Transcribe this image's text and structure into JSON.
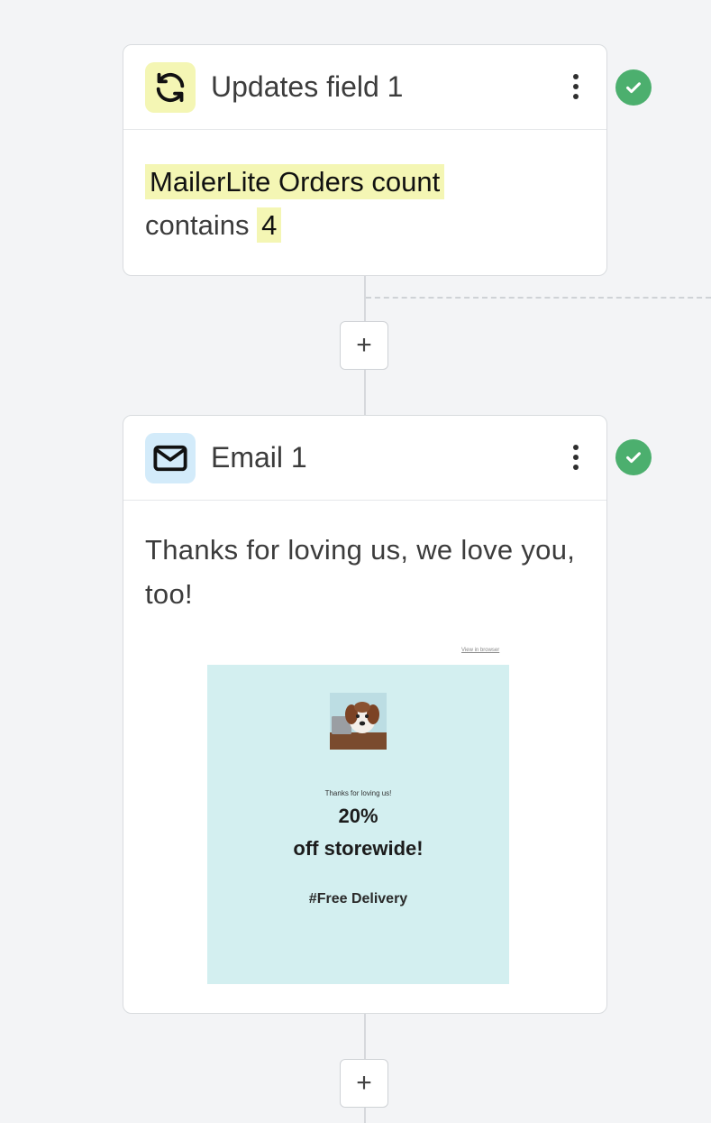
{
  "colors": {
    "background": "#f3f4f6",
    "highlight": "#f4f6b4",
    "success_green": "#4caf6e",
    "preview_bg": "#d3eff0"
  },
  "step_update": {
    "title": "Updates field 1",
    "icon": "sync-icon",
    "icon_bg": "#f4f6b4",
    "condition": {
      "field": "MailerLite Orders count",
      "operator": "contains",
      "value": "4"
    },
    "status": "completed"
  },
  "add_step": {
    "label": "+"
  },
  "step_email": {
    "title": "Email 1",
    "icon": "mail-icon",
    "icon_bg": "#d3ebfa",
    "subject": "Thanks for loving us, we love you, too!",
    "status": "completed",
    "preview": {
      "view_link": "View in browser",
      "intro": "Thanks for loving us!",
      "headline_1": "20%",
      "headline_2": "off storewide!",
      "tagline": "#Free Delivery"
    }
  }
}
